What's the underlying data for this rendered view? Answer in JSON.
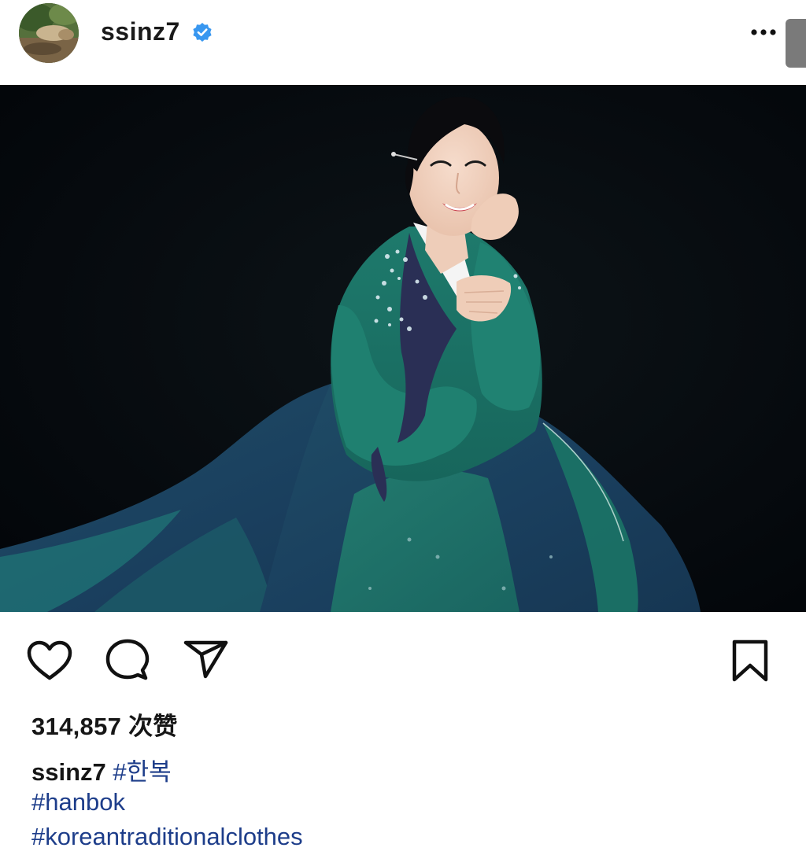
{
  "post": {
    "username": "ssinz7",
    "verified": true,
    "likes_text": "314,857 次赞",
    "caption": {
      "username": "ssinz7",
      "hashtags": [
        "#한복",
        "#hanbok",
        "#koreantraditionalclothes"
      ]
    }
  },
  "icons": {
    "verified": "verified-badge-icon",
    "more": "more-options-icon",
    "like": "heart-icon",
    "comment": "comment-icon",
    "share": "send-icon",
    "save": "bookmark-icon"
  },
  "colors": {
    "background": "#ffffff",
    "text": "#111111",
    "verified_blue": "#3897f0",
    "hashtag": "#1d3d8a",
    "photo_background": "#05080b"
  }
}
